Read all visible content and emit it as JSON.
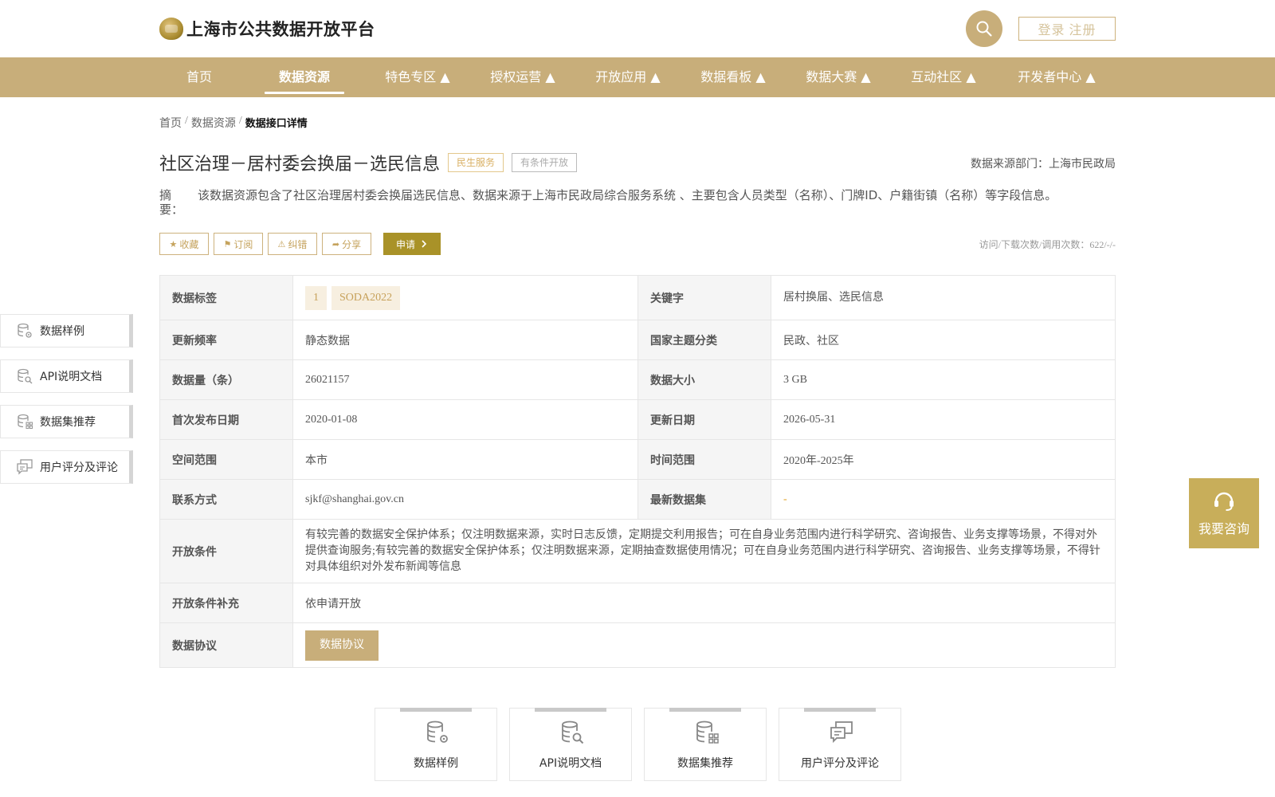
{
  "header": {
    "logo_text": "上海市公共数据开放平台",
    "login_label": "登录 注册",
    "icons": {
      "search": "search-icon"
    }
  },
  "nav": {
    "items": [
      {
        "label": "首页",
        "active": false
      },
      {
        "label": "数据资源",
        "active": true
      },
      {
        "label": "特色专区 ▲",
        "active": false
      },
      {
        "label": "授权运营 ▲",
        "active": false
      },
      {
        "label": "开放应用 ▲",
        "active": false
      },
      {
        "label": "数据看板 ▲",
        "active": false
      },
      {
        "label": "数据大赛 ▲",
        "active": false
      },
      {
        "label": "互动社区 ▲",
        "active": false
      },
      {
        "label": "开发者中心 ▲",
        "active": false
      }
    ]
  },
  "breadcrumb": {
    "home": "首页",
    "resources": "数据资源",
    "current": "数据接口详情",
    "separator": "/"
  },
  "dataset": {
    "title": "社区治理－居村委会换届－选民信息",
    "tags": [
      "民生服务",
      "有条件开放"
    ],
    "source": "数据来源部门：上海市民政局",
    "abstract_label": "摘 要：",
    "abstract": "该数据资源包含了社区治理居村委会换届选民信息、数据来源于上海市民政局综合服务系统 、主要包含人员类型（名称）、门牌ID、户籍街镇（名称）等字段信息。",
    "visits": "访问/下载次数/调用次数：622/-/-"
  },
  "actions": {
    "favorite": "收藏",
    "subscribe": "订阅",
    "correct": "纠错",
    "share": "分享",
    "apply": "申请"
  },
  "info": {
    "labels_label": "数据标签",
    "labels": [
      "1",
      "SODA2022"
    ],
    "keywords_label": "关键字",
    "keywords": "居村换届、选民信息",
    "frequency_label": "更新频率",
    "frequency": "静态数据",
    "theme_label": "国家主题分类",
    "theme": "民政、社区",
    "count_label": "数据量（条）",
    "count": "26021157",
    "size_label": "数据大小",
    "size": "3 GB",
    "first_release_label": "首次发布日期",
    "first_release": "2020-01-08",
    "update_label": "更新日期",
    "update": "2026-05-31",
    "space_label": "空间范围",
    "space": "本市",
    "time_label": "时间范围",
    "time": "2020年-2025年",
    "contact_label": "联系方式",
    "contact": "sjkf@shanghai.gov.cn",
    "latest_label": "最新数据集",
    "latest": "-",
    "conditions_label": "开放条件",
    "conditions": "有较完善的数据安全保护体系；仅注明数据来源，实时日志反馈，定期提交利用报告；可在自身业务范围内进行科学研究、咨询报告、业务支撑等场景，不得对外提供查询服务;有较完善的数据安全保护体系；仅注明数据来源，定期抽查数据使用情况；可在自身业务范围内进行科学研究、咨询报告、业务支撑等场景，不得针对具体组织对外发布新闻等信息",
    "conditions_extra_label": "开放条件补充",
    "conditions_extra": "依申请开放",
    "protocol_label": "数据协议",
    "protocol_button": "数据协议"
  },
  "side_nav": [
    "数据样例",
    "API说明文档",
    "数据集推荐",
    "用户评分及评论"
  ],
  "bottom_cards": [
    "数据样例",
    "API说明文档",
    "数据集推荐",
    "用户评分及评论"
  ],
  "consult": {
    "label": "我要咨询"
  },
  "colors": {
    "brand": "#c8ae7a",
    "apply": "#a99228",
    "consult": "#c8ae5a",
    "chip_bg": "#f7efe0",
    "chip_text": "#c7a15a"
  }
}
